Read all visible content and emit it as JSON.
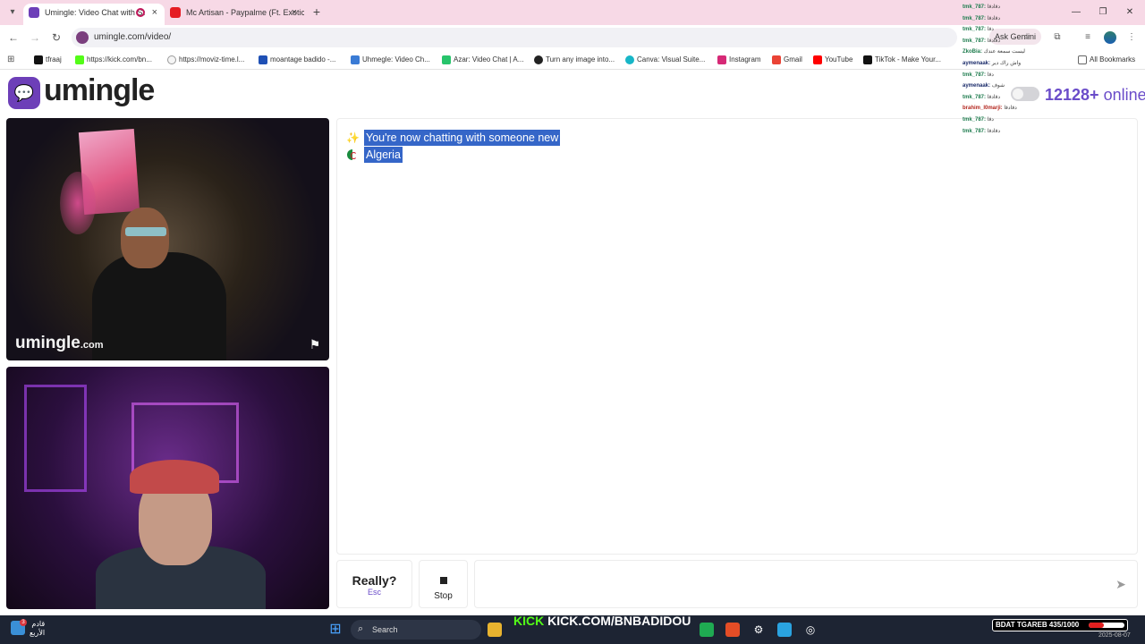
{
  "browser": {
    "tabs": [
      {
        "title": "Umingle: Video Chat with St",
        "color": "#6d3fb8"
      },
      {
        "title": "Mc Artisan - Paypalme (Ft. Exotic",
        "color": "#e51c23"
      }
    ],
    "url": "umingle.com/video/",
    "gemini_label": "Ask Gemini",
    "bookmarks": [
      {
        "label": "tfraaj",
        "icon_color": "#111111"
      },
      {
        "label": "https://kick.com/bn...",
        "icon_color": "#53fc18"
      },
      {
        "label": "https://moviz-time.l...",
        "icon_color": "#f5f5f5"
      },
      {
        "label": "moantage badido -...",
        "icon_color": "#1f50b5"
      },
      {
        "label": "Uhmegle: Video Ch...",
        "icon_color": "#3a7bd5"
      },
      {
        "label": "Azar: Video Chat | A...",
        "icon_color": "#27c46b"
      },
      {
        "label": "Turn any image into...",
        "icon_color": "#222222"
      },
      {
        "label": "Canva: Visual Suite...",
        "icon_color": "#17b6c7"
      },
      {
        "label": "Instagram",
        "icon_color": "#d62976"
      },
      {
        "label": "Gmail",
        "icon_color": "#ea4335"
      },
      {
        "label": "YouTube",
        "icon_color": "#ff0000"
      },
      {
        "label": "TikTok - Make Your...",
        "icon_color": "#111111"
      }
    ],
    "all_bookmarks": "All Bookmarks"
  },
  "page": {
    "logo_text": "umingle",
    "online_count": "12128+",
    "online_label": "online",
    "watermark_brand": "umingle",
    "watermark_tld": ".com",
    "chat": {
      "system_message": "You're now chatting with someone new",
      "country": "Algeria"
    },
    "controls": {
      "really_label": "Really?",
      "really_hint": "Esc",
      "stop_label": "Stop"
    }
  },
  "overlay_chat": [
    {
      "user": "tmk_787:",
      "text": "ﺩﻗﺍﺩﻗﺍ",
      "style": "green"
    },
    {
      "user": "tmk_787:",
      "text": "ﺩﻗﺍﺩﻗﺍ",
      "style": "green"
    },
    {
      "user": "tmk_787:",
      "text": "ﺩﻗﺍ",
      "style": "green"
    },
    {
      "user": "tmk_787:",
      "text": "ﺩﻗﺍﺩﻗﺍ",
      "style": "green"
    },
    {
      "user": "ZkoBia:",
      "text": "ﻟﻴﺴﺖ ﺳﻤﻌﺔ ﻋﻨﺪﻙ",
      "style": "green"
    },
    {
      "user": "aymenaak:",
      "text": "ﻭﺍﺵ ﺭﺍﻙ ﺩﻳﺮ",
      "style": "dark"
    },
    {
      "user": "tmk_787:",
      "text": "ﺩﻗﺍ",
      "style": "green"
    },
    {
      "user": "aymenaak:",
      "text": "ﺷﻮﻑ",
      "style": "dark"
    },
    {
      "user": "tmk_787:",
      "text": "ﺩﻗﺍﺩﻗﺍ",
      "style": "green"
    },
    {
      "user": "brahim_l0marji:",
      "text": "ﺩﻗﺍﺩﻗﺍ",
      "style": "red"
    },
    {
      "user": "tmk_787:",
      "text": "ﺩﻗﺍ",
      "style": "green"
    },
    {
      "user": "tmk_787:",
      "text": "ﺩﻗﺍﺩﻗﺍ",
      "style": "green"
    }
  ],
  "taskbar": {
    "weather_line1": "ﻗﺎﺩﻡ",
    "weather_line2": "ﺍﻷﺭﺑﻊ",
    "badge": "3",
    "search_label": "Search",
    "kick_logo": "KICK",
    "kick_url": "KICK.COM/BNBADIDOU",
    "goal_label": "BDAT TGAREB 435/1000",
    "goal_current": 435,
    "goal_target": 1000,
    "date": "2025-08-07"
  }
}
